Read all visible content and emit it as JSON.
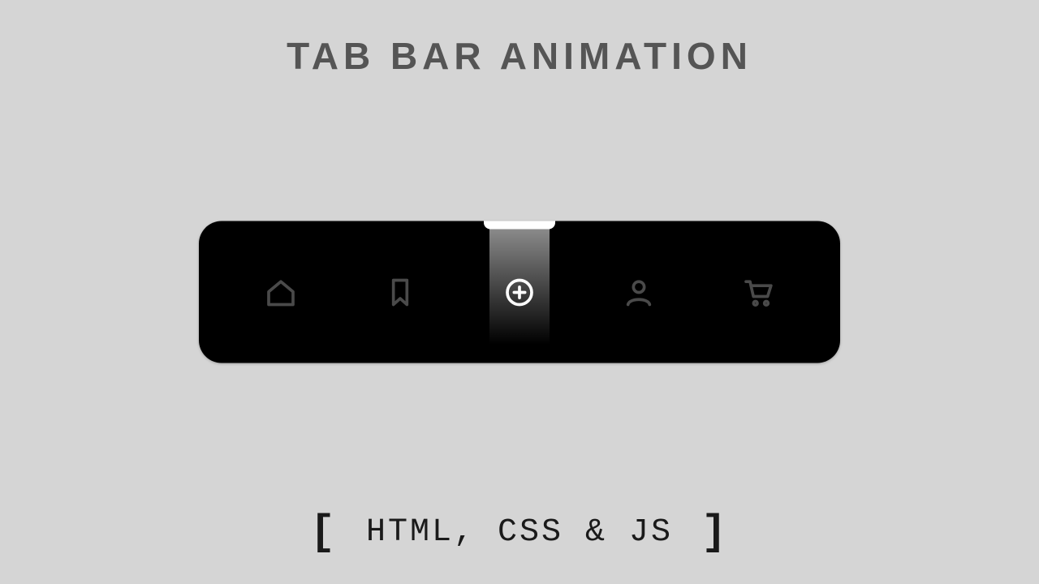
{
  "title": "TAB BAR  ANIMATION",
  "subtitle_inner": "HTML, CSS & JS",
  "bracket_left": "[",
  "bracket_right": "]",
  "colors": {
    "page_bg": "#d5d5d5",
    "title": "#555555",
    "bar_bg": "#000000",
    "icon_inactive": "#4a4a4a",
    "icon_active": "#ffffff"
  },
  "tabbar": {
    "active_index": 2,
    "items": [
      {
        "name": "home",
        "icon": "home-icon"
      },
      {
        "name": "bookmark",
        "icon": "bookmark-icon"
      },
      {
        "name": "add",
        "icon": "plus-circle-icon"
      },
      {
        "name": "profile",
        "icon": "user-icon"
      },
      {
        "name": "cart",
        "icon": "cart-icon"
      }
    ]
  }
}
